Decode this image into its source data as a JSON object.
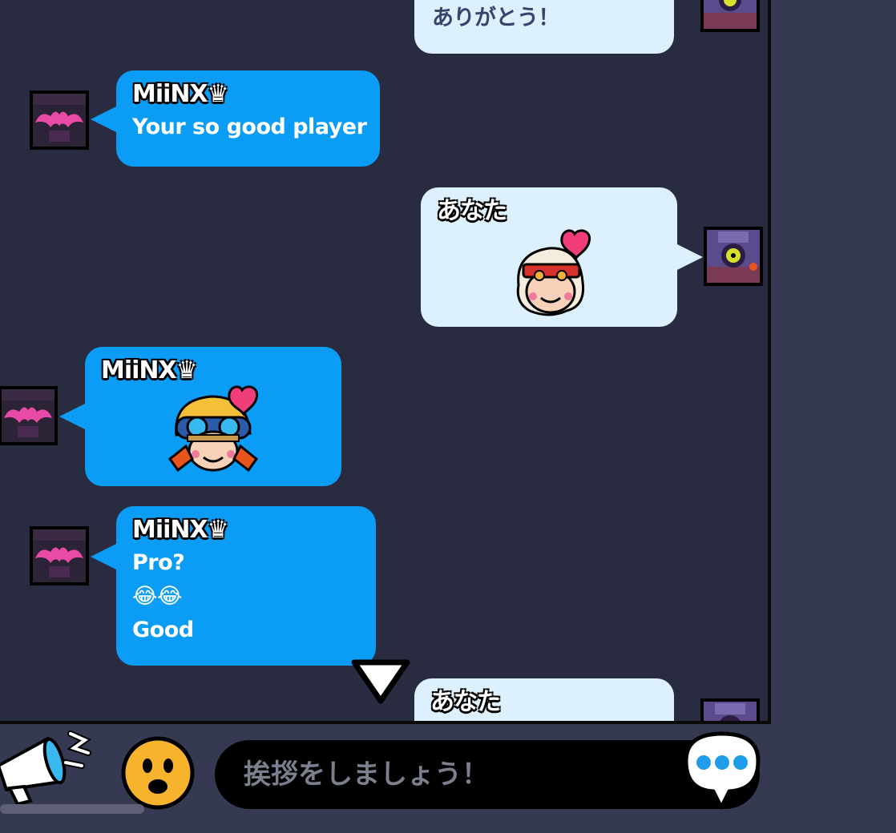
{
  "messages": [
    {
      "text": "ありがとう！"
    },
    {
      "sender": "MiiNX♛",
      "text": "Your so good player"
    },
    {
      "sender": "あなた",
      "emoji_icon": "heart-girl-pin"
    },
    {
      "sender": "MiiNX♛",
      "emoji_icon": "goggles-girl-heart-pin"
    },
    {
      "sender": "MiiNX♛",
      "lines": [
        "Pro?",
        "😂😂",
        "Good"
      ]
    },
    {
      "sender": "あなた"
    }
  ],
  "input": {
    "placeholder": "挨拶をしましょう！"
  },
  "icons": {
    "megaphone": "megaphone-icon",
    "emote": "smiley-emote-icon",
    "send": "chat-bubble-dots-icon",
    "scroll_down": "down-arrow-icon"
  },
  "colors": {
    "their_bubble": "#0b9df5",
    "my_bubble": "#ddf0fd",
    "chat_bg": "#292b40",
    "bar_bg": "#363952"
  }
}
